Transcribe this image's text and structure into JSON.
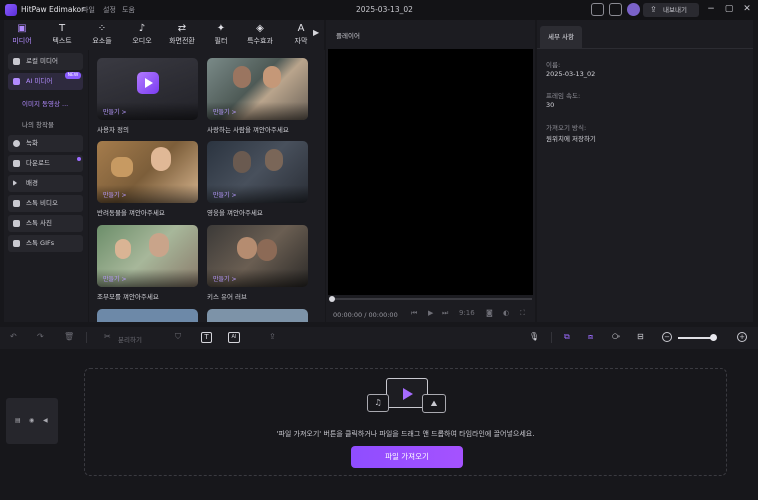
{
  "app": {
    "name": "HitPaw Edimakor",
    "menus": [
      "파일",
      "설정",
      "도움"
    ],
    "project_title": "2025-03-13_02",
    "export_label": "내보내기"
  },
  "toolbar": {
    "tabs": [
      {
        "label": "미디어",
        "icon": "media-icon",
        "active": true
      },
      {
        "label": "텍스트",
        "icon": "text-icon"
      },
      {
        "label": "요소들",
        "icon": "elements-icon"
      },
      {
        "label": "오디오",
        "icon": "audio-icon"
      },
      {
        "label": "화면전환",
        "icon": "transition-icon"
      },
      {
        "label": "필터",
        "icon": "filter-icon"
      },
      {
        "label": "특수효과",
        "icon": "effects-icon"
      },
      {
        "label": "자막",
        "icon": "subtitle-icon"
      }
    ]
  },
  "sidebar": {
    "items": [
      {
        "label": "로컬 미디어"
      },
      {
        "label": "AI 미디어",
        "badge": "NEW"
      },
      {
        "label": "이미지 동영상 ..."
      },
      {
        "label": "나의 창작물"
      },
      {
        "label": "녹화"
      },
      {
        "label": "다운로드"
      },
      {
        "label": "배경"
      },
      {
        "label": "스톡 비디오"
      },
      {
        "label": "스톡 사진"
      },
      {
        "label": "스톡 GIFs"
      }
    ]
  },
  "media": {
    "make_label": "만들기 >",
    "cards": [
      {
        "caption": "사용자 정의"
      },
      {
        "caption": "사랑하는 사람을 껴안아주세요"
      },
      {
        "caption": "반려동물을 껴안아주세요"
      },
      {
        "caption": "영웅을 껴안아주세요"
      },
      {
        "caption": "조부모를 껴안아주세요"
      },
      {
        "caption": "키스 유어 러브"
      }
    ]
  },
  "player": {
    "label": "플레이어",
    "timecode": "00:00:00 / 00:00:00",
    "ratio": "9:16"
  },
  "details": {
    "tab": "세부 사항",
    "name_label": "이름:",
    "name_value": "2025-03-13_02",
    "fps_label": "프레임 속도:",
    "fps_value": "30",
    "import_label": "가져오기 방식:",
    "import_value": "원위치에 저장하기"
  },
  "timeline": {
    "split_label": "분리하기",
    "drop_text": "'파일 가져오기' 버튼을 클릭하거나 파일을 드래그 앤 드롭하여 타임라인에 끌어넣으세요.",
    "import_button": "파일 가져오기"
  },
  "colors": {
    "accent": "#9b6bff",
    "background": "#17171b",
    "panel": "#1c1c21"
  }
}
